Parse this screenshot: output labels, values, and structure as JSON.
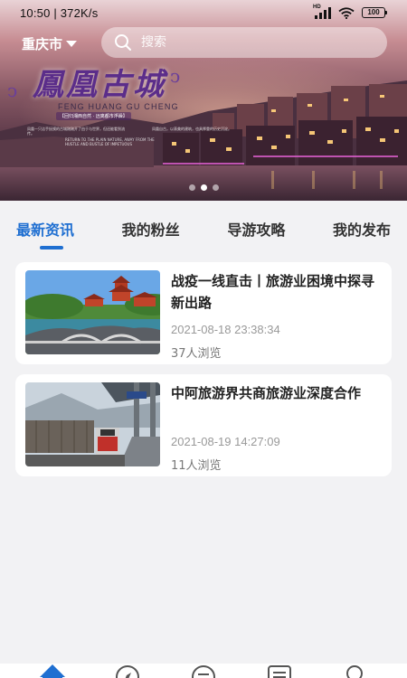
{
  "status_bar": {
    "time_speed": "10:50 | 372K/s",
    "network": "HD",
    "battery": "100"
  },
  "header": {
    "city": "重庆市",
    "search_placeholder": "搜索"
  },
  "banner": {
    "title": "鳳凰古城",
    "subtitle": "FENG HUANG GU CHENG",
    "slogan": "【回归湘西自然 · 远离都市浮躁】",
    "caption_left": "凤凰一只洁手抚摸的古城刚刚开了由于与世界，但还能看到流传。",
    "caption_center": "RETURN TO THE PLAIN NATURE, AWAY FROM THE HUSTLE AND BUSTLE OF IMPETUOUS",
    "caption_right": "凤凰自古，以表美的建筑，也具厚重的历史沉淀。",
    "slides_total": 3,
    "slide_active": 1
  },
  "tabs": [
    {
      "label": "最新资讯",
      "active": true
    },
    {
      "label": "我的粉丝",
      "active": false
    },
    {
      "label": "导游攻略",
      "active": false
    },
    {
      "label": "我的发布",
      "active": false
    }
  ],
  "articles": [
    {
      "title": "战疫一线直击丨旅游业困境中探寻新出路",
      "date": "2021-08-18 23:38:34",
      "views": "37人浏览",
      "thumb": "pagoda-bridge-image"
    },
    {
      "title": "中阿旅游界共商旅游业深度合作",
      "date": "2021-08-19 14:27:09",
      "views": "11人浏览",
      "thumb": "train-station-image"
    }
  ],
  "bottom_nav": [
    {
      "icon": "home-icon",
      "active": true
    },
    {
      "icon": "compass-icon",
      "active": false
    },
    {
      "icon": "message-icon",
      "active": false
    },
    {
      "icon": "list-icon",
      "active": false
    },
    {
      "icon": "profile-icon",
      "active": false
    }
  ],
  "colors": {
    "accent": "#1f6fd1",
    "background": "#f2f2f4",
    "card": "#ffffff",
    "muted_text": "#999999"
  }
}
